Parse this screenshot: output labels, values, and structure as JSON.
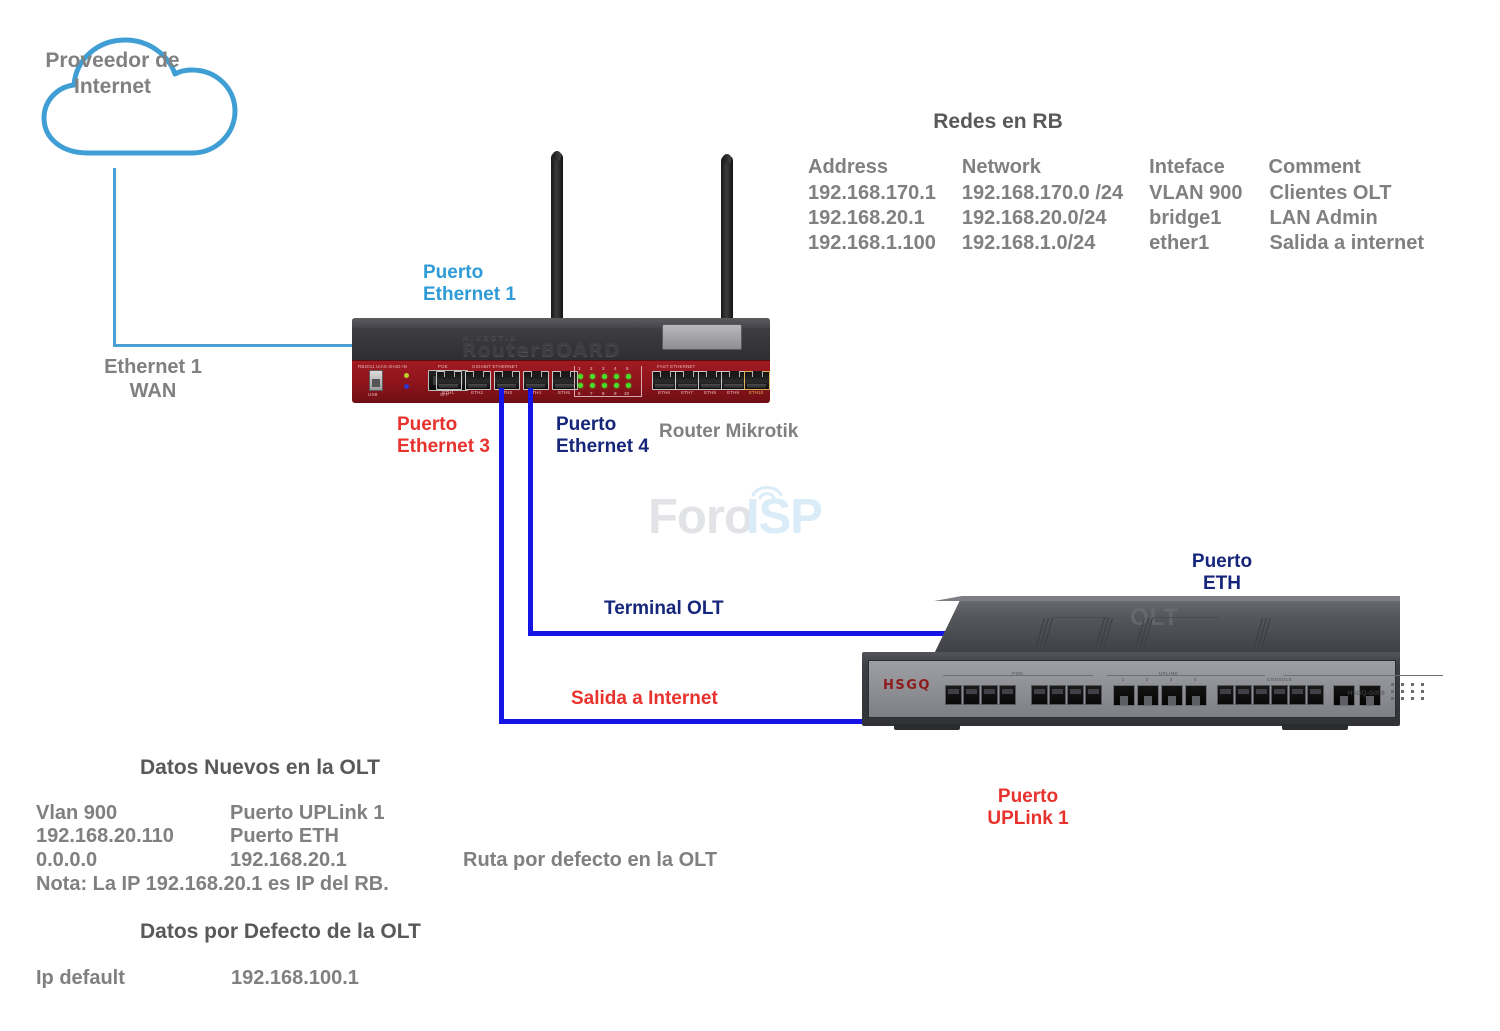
{
  "cloud": {
    "label": "Proveedor de\nInternet",
    "color": "#3f9fd4"
  },
  "labels": {
    "wan": "Ethernet 1\nWAN",
    "puerto_eth1": "Puerto\nEthernet 1",
    "puerto_eth3": "Puerto\nEthernet 3",
    "puerto_eth4": "Puerto\nEthernet 4",
    "router_name": "Router Mikrotik",
    "terminal_olt": "Terminal OLT",
    "salida_internet": "Salida a Internet",
    "puerto_eth_olt": "Puerto\nETH",
    "puerto_uplink1": "Puerto\nUPLink 1"
  },
  "colors": {
    "cyan": "#2e9bd6",
    "red": "#e8322d",
    "navy": "#16267a",
    "gray": "#808080",
    "cable_blue": "#1414e6",
    "cable_cyan": "#4a9fd4",
    "router_red": "#a11a22"
  },
  "networks_table": {
    "title": "Redes en RB",
    "headers": [
      "Address",
      "Network",
      "Inteface",
      "Comment"
    ],
    "rows": [
      [
        "192.168.170.1",
        "192.168.170.0 /24",
        "VLAN 900",
        "Clientes OLT"
      ],
      [
        "192.168.20.1",
        "192.168.20.0/24",
        "bridge1",
        "LAN Admin"
      ],
      [
        "192.168.1.100",
        "192.168.1.0/24",
        "ether1",
        "Salida a internet"
      ]
    ]
  },
  "olt_new_data": {
    "title": "Datos Nuevos en  la OLT",
    "rows": [
      [
        "Vlan 900",
        "Puerto UPLink 1",
        ""
      ],
      [
        "192.168.20.110",
        "Puerto ETH",
        ""
      ],
      [
        "0.0.0.0",
        "192.168.20.1",
        "Ruta  por defecto en la OLT"
      ]
    ],
    "note": "Nota: La IP 192.168.20.1 es IP del RB."
  },
  "olt_default_data": {
    "title": "Datos por Defecto de la OLT",
    "rows": [
      [
        "Ip default",
        "192.168.100.1"
      ]
    ]
  },
  "router_device": {
    "brand_small": "MIKROTIK",
    "brand": "RouterBOARD",
    "model_text": "RB2011 UiAS-2HnD-IN",
    "poe_label": "POE",
    "gigabit_label": "GIGABIT ETHERNET",
    "fast_label": "FAST ETHERNET",
    "usb_label": "USB",
    "sfp_label": "SFP",
    "gigabit_ports": [
      "ETH1",
      "ETH2",
      "ETH3",
      "ETH4",
      "ETH5"
    ],
    "fast_ports": [
      "ETH6",
      "ETH7",
      "ETH8",
      "ETH9",
      "ETH10"
    ],
    "led_numbers_top": [
      "1",
      "2",
      "3",
      "4",
      "5"
    ],
    "led_numbers_bottom": [
      "6",
      "7",
      "8",
      "9",
      "10"
    ]
  },
  "olt_device": {
    "brand": "HSGQ",
    "model": "HSGQ-G008",
    "top_watermark": "OLT",
    "pon_label": "PON",
    "uplink_label": "UPLINK",
    "console_label": "CONSOLE",
    "uplink_ports": [
      "1",
      "2",
      "3",
      "4"
    ],
    "sfp_ports": [
      "1",
      "2",
      "3",
      "4",
      "SG1",
      "SG2"
    ]
  },
  "watermark": {
    "part1": "Foro",
    "part2": "ISP"
  }
}
